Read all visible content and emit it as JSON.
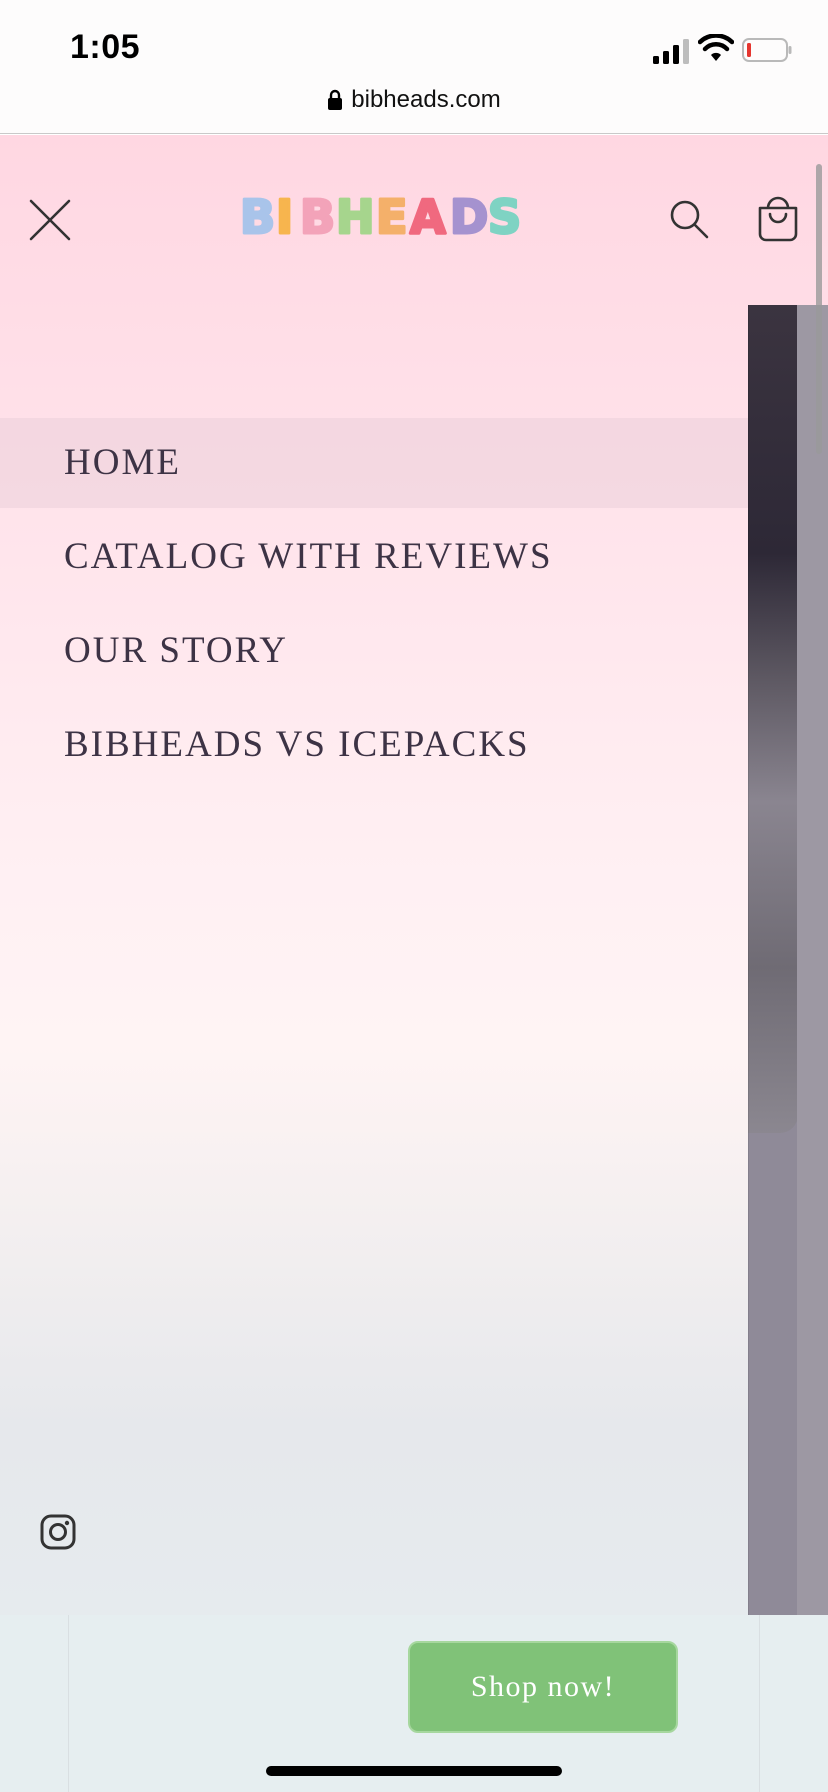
{
  "status_bar": {
    "time": "1:05",
    "icons": [
      "cellular-signal-icon",
      "wifi-icon",
      "battery-low-icon"
    ]
  },
  "browser": {
    "url": "bibheads.com",
    "icon": "lock-icon"
  },
  "header": {
    "logo_text": "BIBHEADS",
    "logo_letters": [
      {
        "char": "B",
        "color": "#a9c4ea"
      },
      {
        "char": "I",
        "color": "#f7b54e"
      },
      {
        "char": "B",
        "color": "#f3a3b9"
      },
      {
        "char": "H",
        "color": "#a6d58d"
      },
      {
        "char": "E",
        "color": "#f4b06a"
      },
      {
        "char": "A",
        "color": "#f0697f"
      },
      {
        "char": "D",
        "color": "#a592cf"
      },
      {
        "char": "S",
        "color": "#7fd3c3"
      }
    ],
    "icons": [
      "close-icon",
      "search-icon",
      "cart-icon"
    ]
  },
  "menu": {
    "items": [
      {
        "label": "HOME",
        "active": true
      },
      {
        "label": "CATALOG WITH REVIEWS",
        "active": false
      },
      {
        "label": "OUR STORY",
        "active": false
      },
      {
        "label": "BIBHEADS VS ICEPACKS",
        "active": false
      }
    ],
    "social_icon": "instagram-icon"
  },
  "cta": {
    "label": "Shop now!",
    "color": "#80c278"
  },
  "colors": {
    "menu_text": "#3d3345",
    "drawer_top": "#ffd7e2",
    "drawer_bottom": "#e6eef0"
  }
}
